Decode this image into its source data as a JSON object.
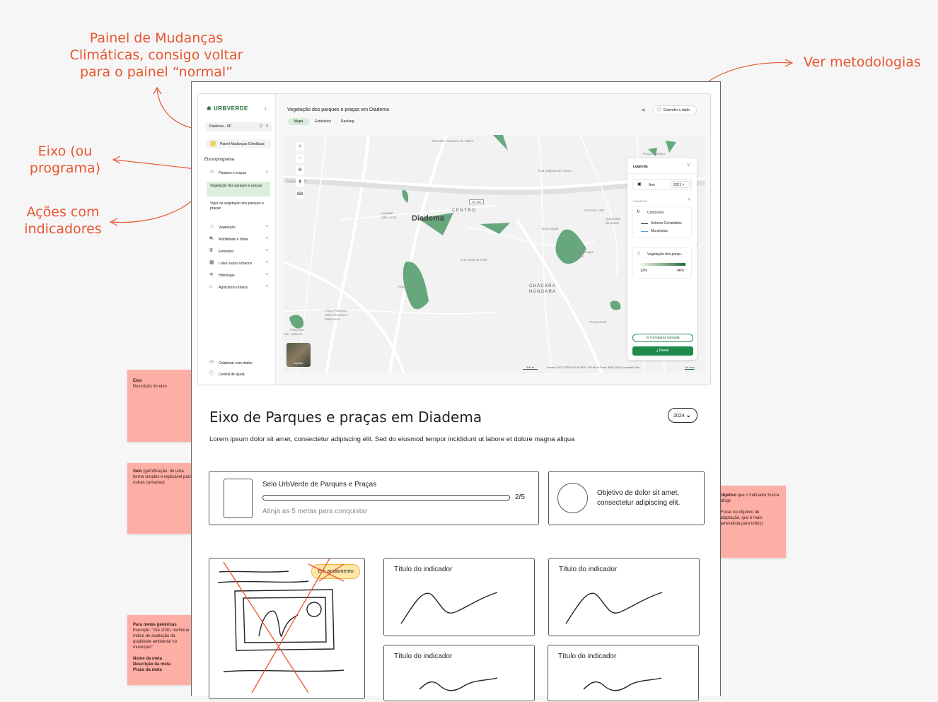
{
  "annotations": {
    "painel": "Painel de Mudanças Climáticas, consigo voltar para o painel “normal”",
    "metodologias": "Ver metodologias",
    "eixo": "Eixo (ou programa)",
    "acoes": "Ações com indicadores"
  },
  "stickies": {
    "eixo": {
      "bold": "Eixo",
      "text": "Descrição do eixo"
    },
    "selo": {
      "bold": "Selo",
      "text": " (gamificação, de uma forma simples e replicável para outras camadas)"
    },
    "objetivo": {
      "bold": "Objetivo",
      "text": " que o indicador busca atingir",
      "note": "(Focar no objetivo de adaptação, que é mais generalista para todos)"
    },
    "metas": {
      "bold": "Para metas genéricas",
      "text": "Exemplo: \"Até 2030, melhorar índice de avaliação da qualidade ambiental no município\"",
      "bold2": "Nome da meta",
      "bold3": "Descrição da meta",
      "bold4": "Prazo da meta"
    }
  },
  "app": {
    "logo": "URBVERDE",
    "search_value": "Diadema - SP",
    "painel_button": "Painel Mudanças Climáticas",
    "section_label": "Eixos/programa",
    "active_group": "Parques e praças",
    "sub_items": [
      "Vegetação dos parques e praças",
      "Vigor da vegetação dos parques e praças"
    ],
    "groups": [
      "Vegetação",
      "Mobilidade e clima",
      "Emissões",
      "Lotes vazios urbanos",
      "Hidrologia",
      "Agricultura urbana"
    ],
    "footer": [
      "Colaborar com dados",
      "Central de ajuda"
    ],
    "title": "Vegetação dos parques e praças em Diadema",
    "tabs": [
      "Mapa",
      "Estatística",
      "Ranking"
    ],
    "entender": "Entender o dado",
    "legend": {
      "title": "Legenda",
      "ano_label": "Ano",
      "ano_value": "2021",
      "camadas": "CAMADAS",
      "contornos": "Contornos",
      "setores": "Setores Censitários",
      "municipios": "Municípios",
      "vegetacao": "Vegetação dos parqu...",
      "min": "12%",
      "max": "46%",
      "comparar": "Comparar camada",
      "baixar": "Baixar"
    },
    "map_labels": {
      "city": "Diadema",
      "centro": "CENTRO",
      "chacara": "CHÁCARA HÚNGARA",
      "road": "SP-180",
      "satelite": "Satélite",
      "scale": "200 m",
      "footer": "Escala 1:100    23°33'34.3\"S  46°53'57.3\"W  810 m    Fonte: IBGE (2010), Landsat 8, Sen...",
      "ver_mais": "Ver mais"
    }
  },
  "content": {
    "heading": "Eixo de Parques e praças em Diadema",
    "year": "2024",
    "description": "Lorem ipsum dolor sit amet, consectetur adipiscing elit. Sed do eiusmod tempor incididunt ut labore et dolore magna aliqua",
    "selo_title": "Selo UrbVerde de Parques e Praças",
    "selo_progress": "2/5",
    "selo_progress_value": 0,
    "selo_sub": "Atinja as 5 metas para conquistar",
    "objetivo": "Objetivo de dolor sit amet, consectetur adipiscing elit.",
    "badge": "Em andamento",
    "indicator_title": "Título do indicador"
  }
}
